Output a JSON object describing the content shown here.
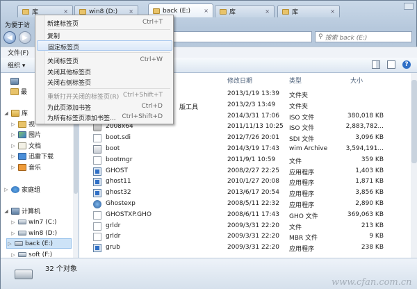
{
  "tabs": [
    {
      "label": "库"
    },
    {
      "label": "win8 (D:)"
    },
    {
      "label": "back (E:)"
    },
    {
      "label": "库"
    },
    {
      "label": "库"
    }
  ],
  "title_hint": "为便于访",
  "search": {
    "placeholder": "搜索 back (E:)"
  },
  "menubar": {
    "file": "文件(F)"
  },
  "toolbar": {
    "organize": "组织 ▾"
  },
  "nav": {
    "library": "库",
    "lib_partial": "视",
    "pictures": "图片",
    "documents": "文档",
    "downloads": "迅雷下载",
    "music": "音乐",
    "homegroup": "家庭组",
    "computer": "计算机",
    "drives": [
      {
        "label": "win7 (C:)"
      },
      {
        "label": "win8 (D:)"
      },
      {
        "label": "back (E:)"
      },
      {
        "label": "soft (F:)"
      }
    ],
    "top_partial": "最"
  },
  "columns": {
    "date": "修改日期",
    "type": "类型",
    "size": "大小"
  },
  "partial_name": "版工具",
  "files": [
    {
      "name": "",
      "date": "2013/1/19 13:39",
      "type": "文件夹",
      "size": "",
      "icon": "folder"
    },
    {
      "name": "",
      "date": "2013/2/3 13:49",
      "type": "文件夹",
      "size": "",
      "icon": "folder"
    },
    {
      "name": "",
      "date": "2014/3/31 17:06",
      "type": "ISO 文件",
      "size": "380,018 KB",
      "icon": "iso"
    },
    {
      "name": "2008x64",
      "date": "2011/11/13 10:25",
      "type": "ISO 文件",
      "size": "2,883,782...",
      "icon": "iso"
    },
    {
      "name": "boot.sdi",
      "date": "2012/7/26 20:01",
      "type": "SDI 文件",
      "size": "3,096 KB",
      "icon": "file"
    },
    {
      "name": "boot",
      "date": "2014/3/19 17:43",
      "type": "wim Archive",
      "size": "3,594,191...",
      "icon": "wim"
    },
    {
      "name": "bootmgr",
      "date": "2011/9/1 10:59",
      "type": "文件",
      "size": "359 KB",
      "icon": "file"
    },
    {
      "name": "GHOST",
      "date": "2008/2/27 22:25",
      "type": "应用程序",
      "size": "1,403 KB",
      "icon": "app"
    },
    {
      "name": "ghost11",
      "date": "2010/1/27 20:08",
      "type": "应用程序",
      "size": "1,871 KB",
      "icon": "app"
    },
    {
      "name": "ghost32",
      "date": "2013/6/17 20:54",
      "type": "应用程序",
      "size": "3,856 KB",
      "icon": "app"
    },
    {
      "name": "Ghostexp",
      "date": "2008/5/11 22:32",
      "type": "应用程序",
      "size": "2,890 KB",
      "icon": "ghostexp"
    },
    {
      "name": "GHOSTXP.GHO",
      "date": "2008/6/11 17:43",
      "type": "GHO 文件",
      "size": "369,063 KB",
      "icon": "file"
    },
    {
      "name": "grldr",
      "date": "2009/3/31 22:20",
      "type": "文件",
      "size": "213 KB",
      "icon": "file"
    },
    {
      "name": "grldr",
      "date": "2009/3/31 22:20",
      "type": "MBR 文件",
      "size": "9 KB",
      "icon": "file"
    },
    {
      "name": "grub",
      "date": "2009/3/31 22:20",
      "type": "应用程序",
      "size": "238 KB",
      "icon": "app"
    }
  ],
  "context_menu": {
    "new_tab": "新建标签页",
    "new_tab_sc": "Ctrl+T",
    "copy": "复制",
    "pin": "固定标签页",
    "close_tab": "关闭标签页",
    "close_tab_sc": "Ctrl+W",
    "close_others": "关闭其他标签页",
    "close_right": "关闭右侧标签页",
    "reopen": "重新打开关闭的标签页(R)",
    "reopen_sc": "Ctrl+Shift+T",
    "bookmark": "为此页添加书签",
    "bookmark_sc": "Ctrl+D",
    "bookmark_all": "为所有标签页添加书签...",
    "bookmark_all_sc": "Ctrl+Shift+D"
  },
  "status": {
    "count": "32 个对象"
  },
  "watermark": "www.cfan.com.cn"
}
